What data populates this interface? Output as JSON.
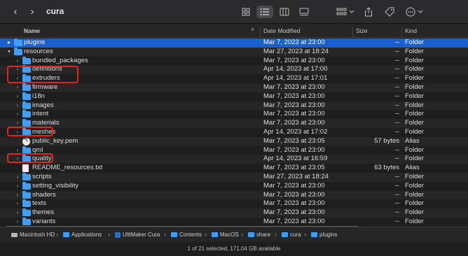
{
  "window": {
    "title": "cura"
  },
  "toolbar": {
    "back_icon": "chevron-left-icon",
    "forward_icon": "chevron-right-icon",
    "views": [
      "icon-view-icon",
      "list-view-icon",
      "column-view-icon",
      "gallery-view-icon"
    ],
    "group_icon": "group-icon",
    "share_icon": "share-icon",
    "tag_icon": "tag-icon",
    "more_icon": "more-icon"
  },
  "columns": {
    "name": "Name",
    "date": "Date Modified",
    "size": "Size",
    "kind": "Kind"
  },
  "rows": [
    {
      "name": "plugins",
      "date": "Mar 7, 2023 at 23:00",
      "size": "--",
      "kind": "Folder",
      "icon": "folder",
      "indent": 0,
      "expand": "▸",
      "selected": true
    },
    {
      "name": "resources",
      "date": "Mar 27, 2023 at 18:24",
      "size": "--",
      "kind": "Folder",
      "icon": "folder",
      "indent": 0,
      "expand": "▾"
    },
    {
      "name": "bundled_packages",
      "date": "Mar 7, 2023 at 23:00",
      "size": "--",
      "kind": "Folder",
      "icon": "folder",
      "indent": 1,
      "expand": "›"
    },
    {
      "name": "definitions",
      "date": "Apr 14, 2023 at 17:00",
      "size": "--",
      "kind": "Folder",
      "icon": "folder",
      "indent": 1,
      "expand": "›"
    },
    {
      "name": "extruders",
      "date": "Apr 14, 2023 at 17:01",
      "size": "--",
      "kind": "Folder",
      "icon": "folder",
      "indent": 1,
      "expand": "›"
    },
    {
      "name": "firmware",
      "date": "Mar 7, 2023 at 23:00",
      "size": "--",
      "kind": "Folder",
      "icon": "folder",
      "indent": 1,
      "expand": "›"
    },
    {
      "name": "i18n",
      "date": "Mar 7, 2023 at 23:00",
      "size": "--",
      "kind": "Folder",
      "icon": "folder",
      "indent": 1,
      "expand": "›"
    },
    {
      "name": "images",
      "date": "Mar 7, 2023 at 23:00",
      "size": "--",
      "kind": "Folder",
      "icon": "folder",
      "indent": 1,
      "expand": "›"
    },
    {
      "name": "intent",
      "date": "Mar 7, 2023 at 23:00",
      "size": "--",
      "kind": "Folder",
      "icon": "folder",
      "indent": 1,
      "expand": "›"
    },
    {
      "name": "materials",
      "date": "Mar 7, 2023 at 23:00",
      "size": "--",
      "kind": "Folder",
      "icon": "folder",
      "indent": 1,
      "expand": "›"
    },
    {
      "name": "meshes",
      "date": "Apr 14, 2023 at 17:02",
      "size": "--",
      "kind": "Folder",
      "icon": "folder",
      "indent": 1,
      "expand": "›"
    },
    {
      "name": "public_key.pem",
      "date": "Mar 7, 2023 at 23:05",
      "size": "57 bytes",
      "kind": "Alias",
      "icon": "alias",
      "indent": 1,
      "expand": ""
    },
    {
      "name": "qml",
      "date": "Mar 7, 2023 at 23:00",
      "size": "--",
      "kind": "Folder",
      "icon": "folder",
      "indent": 1,
      "expand": "›"
    },
    {
      "name": "quality",
      "date": "Apr 14, 2023 at 16:59",
      "size": "--",
      "kind": "Folder",
      "icon": "folder",
      "indent": 1,
      "expand": "›"
    },
    {
      "name": "README_resources.txt",
      "date": "Mar 7, 2023 at 23:05",
      "size": "63 bytes",
      "kind": "Alias",
      "icon": "doc",
      "indent": 1,
      "expand": ""
    },
    {
      "name": "scripts",
      "date": "Mar 27, 2023 at 18:24",
      "size": "--",
      "kind": "Folder",
      "icon": "folder",
      "indent": 1,
      "expand": "›"
    },
    {
      "name": "setting_visibility",
      "date": "Mar 7, 2023 at 23:00",
      "size": "--",
      "kind": "Folder",
      "icon": "folder",
      "indent": 1,
      "expand": "›"
    },
    {
      "name": "shaders",
      "date": "Mar 7, 2023 at 23:00",
      "size": "--",
      "kind": "Folder",
      "icon": "folder",
      "indent": 1,
      "expand": "›"
    },
    {
      "name": "texts",
      "date": "Mar 7, 2023 at 23:00",
      "size": "--",
      "kind": "Folder",
      "icon": "folder",
      "indent": 1,
      "expand": "›"
    },
    {
      "name": "themes",
      "date": "Mar 7, 2023 at 23:00",
      "size": "--",
      "kind": "Folder",
      "icon": "folder",
      "indent": 1,
      "expand": "›"
    },
    {
      "name": "variants",
      "date": "Mar 7, 2023 at 23:00",
      "size": "--",
      "kind": "Folder",
      "icon": "folder",
      "indent": 1,
      "expand": "›"
    }
  ],
  "pathbar": [
    {
      "label": "Macintosh HD",
      "icon": "disk"
    },
    {
      "label": "Applications",
      "icon": "folder"
    },
    {
      "label": "UltiMaker Cura",
      "icon": "app"
    },
    {
      "label": "Contents",
      "icon": "folder"
    },
    {
      "label": "MacOS",
      "icon": "folder"
    },
    {
      "label": "share",
      "icon": "folder"
    },
    {
      "label": "cura",
      "icon": "folder"
    },
    {
      "label": "plugins",
      "icon": "folder"
    }
  ],
  "status": "1 of 21 selected, 171.04 GB available",
  "colors": {
    "selection": "#1a5fd0",
    "folder": "#3f9ef5",
    "highlight": "#e8221b"
  }
}
